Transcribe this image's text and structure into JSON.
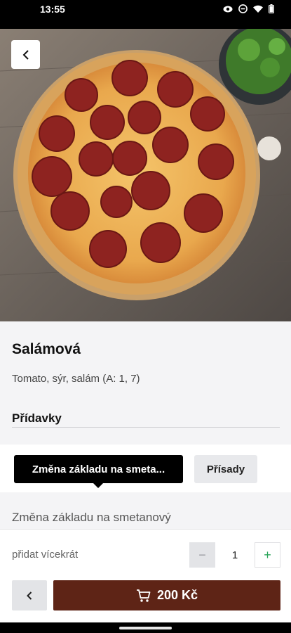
{
  "status_bar": {
    "time": "13:55"
  },
  "product": {
    "name": "Salámová",
    "description": "Tomato, sýr, salám (A: 1, 7)"
  },
  "extras_heading": "Přídavky",
  "tabs": [
    {
      "label": "Změna základu na smeta...",
      "active": true
    },
    {
      "label": "Přísady",
      "active": false
    }
  ],
  "option_label": "Změna základu na smetanový",
  "quantity": {
    "label": "přidat vícekrát",
    "value": "1",
    "minus": "−",
    "plus": "+"
  },
  "cart": {
    "price_label": "200 Kč"
  },
  "colors": {
    "accent": "#5e2416",
    "plus_green": "#2aa55a",
    "tab_active_bg": "#000000"
  },
  "icons": {
    "back": "chevron-left-icon",
    "cart": "cart-icon"
  }
}
